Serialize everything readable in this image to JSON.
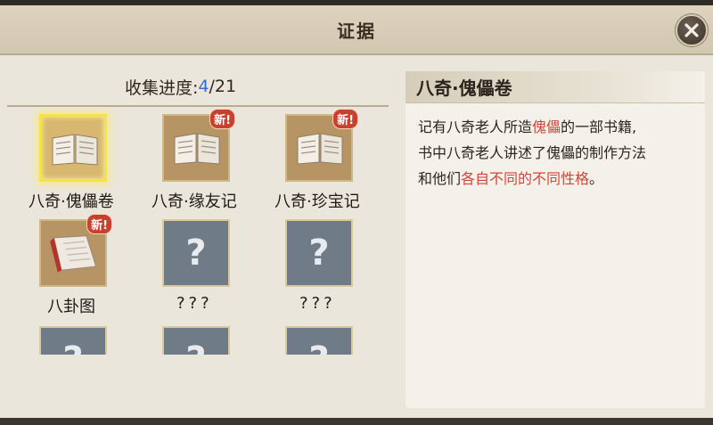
{
  "header": {
    "title": "证据"
  },
  "progress": {
    "label": "收集进度:",
    "current": "4",
    "total": "/21"
  },
  "items": [
    {
      "label": "八奇·傀儡卷",
      "kind": "book",
      "new": false,
      "selected": true
    },
    {
      "label": "八奇·缘友记",
      "kind": "book",
      "new": true,
      "selected": false
    },
    {
      "label": "八奇·珍宝记",
      "kind": "book",
      "new": true,
      "selected": false
    },
    {
      "label": "八卦图",
      "kind": "cloth",
      "new": true,
      "selected": false
    },
    {
      "label": "???",
      "kind": "unknown",
      "new": false,
      "selected": false
    },
    {
      "label": "???",
      "kind": "unknown",
      "new": false,
      "selected": false
    },
    {
      "label": "",
      "kind": "unknown",
      "new": false,
      "selected": false
    },
    {
      "label": "",
      "kind": "unknown",
      "new": false,
      "selected": false
    },
    {
      "label": "",
      "kind": "unknown",
      "new": false,
      "selected": false
    }
  ],
  "new_badge": "新!",
  "unknown_mark": "?",
  "detail": {
    "title": "八奇·傀儡卷",
    "line1_a": "记有八奇老人所造",
    "line1_hl": "傀儡",
    "line1_b": "的一部书籍,",
    "line2": "书中八奇老人讲述了傀儡的制作方法",
    "line3_a": "和他们",
    "line3_hl": "各自不同的不同性格",
    "line3_b": "。"
  },
  "colors": {
    "highlight": "#d2453b",
    "progress_current": "#2f6ec8",
    "selected_glow": "#f3e24a",
    "new_badge": "#c9412e"
  }
}
